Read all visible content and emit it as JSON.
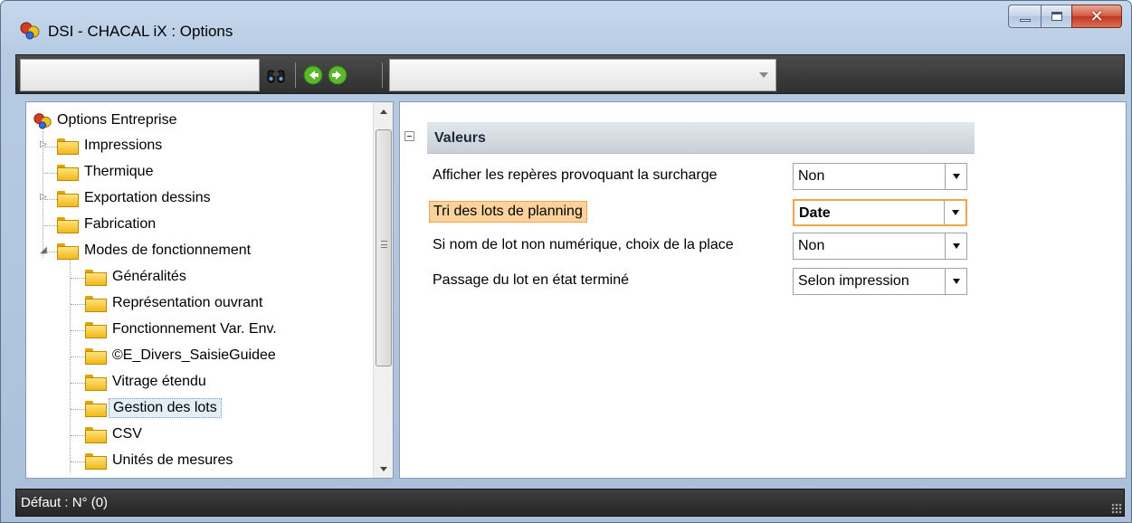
{
  "window": {
    "title": "DSI - CHACAL iX : Options",
    "buttons": [
      "minimize",
      "maximize",
      "close"
    ]
  },
  "toolbar": {
    "search_value": "",
    "icons": [
      "binoculars-icon",
      "back-arrow-icon",
      "forward-arrow-icon"
    ],
    "combo_value": ""
  },
  "tree": {
    "root_label": "Options Entreprise",
    "items": [
      {
        "label": "Impressions",
        "level": 1,
        "expander": "collapsed"
      },
      {
        "label": "Thermique",
        "level": 1,
        "expander": "none"
      },
      {
        "label": "Exportation dessins",
        "level": 1,
        "expander": "collapsed"
      },
      {
        "label": "Fabrication",
        "level": 1,
        "expander": "none"
      },
      {
        "label": "Modes de fonctionnement",
        "level": 1,
        "expander": "expanded"
      },
      {
        "label": "Généralités",
        "level": 2
      },
      {
        "label": "Représentation ouvrant",
        "level": 2
      },
      {
        "label": "Fonctionnement Var. Env.",
        "level": 2
      },
      {
        "label": "©E_Divers_SaisieGuidee",
        "level": 2
      },
      {
        "label": "Vitrage étendu",
        "level": 2
      },
      {
        "label": "Gestion des lots",
        "level": 2,
        "selected": true
      },
      {
        "label": "CSV",
        "level": 2
      },
      {
        "label": "Unités de mesures",
        "level": 2
      }
    ]
  },
  "properties": {
    "category": "Valeurs",
    "rows": [
      {
        "label": "Afficher les repères provoquant la surcharge",
        "value": "Non"
      },
      {
        "label": "Tri des lots de planning",
        "value": "Date",
        "active": true
      },
      {
        "label": "Si nom de lot non numérique, choix de la place",
        "value": "Non"
      },
      {
        "label": "Passage du lot en état terminé",
        "value": "Selon impression"
      }
    ]
  },
  "status": {
    "text": "Défaut : N° (0)"
  },
  "colors": {
    "title_bg": "#b6cbe3",
    "toolbar_bg": "#3a3a3a",
    "active_highlight": "#fbd29b",
    "active_border": "#f3a44a",
    "close_button": "#c2371c"
  }
}
